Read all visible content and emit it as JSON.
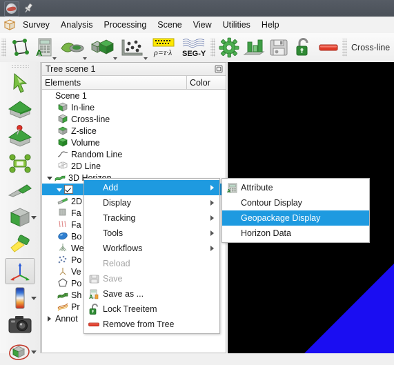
{
  "window": {
    "app_icon": "opendtect-globe-icon",
    "pin_icon": "pin-icon"
  },
  "menubar": {
    "logo_icon": "cube-logo-icon",
    "items": [
      {
        "label": "Survey",
        "name": "menu-survey"
      },
      {
        "label": "Analysis",
        "name": "menu-analysis"
      },
      {
        "label": "Processing",
        "name": "menu-processing"
      },
      {
        "label": "Scene",
        "name": "menu-scene"
      },
      {
        "label": "View",
        "name": "menu-view"
      },
      {
        "label": "Utilities",
        "name": "menu-utilities"
      },
      {
        "label": "Help",
        "name": "menu-help"
      }
    ]
  },
  "toolbar": {
    "buttons": [
      {
        "icon": "survey-polygon-icon",
        "name": "toolbar-survey-setup",
        "arrow": false
      },
      {
        "icon": "attribute-calculator-icon",
        "name": "toolbar-attributes",
        "arrow": true
      },
      {
        "icon": "cross-plot-icon",
        "name": "toolbar-crossplot",
        "arrow": true
      },
      {
        "icon": "volume-builder-icon",
        "name": "toolbar-volume-builder",
        "arrow": true
      },
      {
        "icon": "wells-scatter-icon",
        "name": "toolbar-manage-data",
        "arrow": true
      },
      {
        "icon": "rock-physics-icon",
        "name": "toolbar-rock-physics",
        "arrow": false
      },
      {
        "icon": "segy-icon",
        "name": "toolbar-segy",
        "arrow": false
      },
      {
        "icon": "gear-green-icon",
        "name": "toolbar-batch-processing",
        "arrow": false
      },
      {
        "icon": "bar-chart-icon",
        "name": "toolbar-statistics",
        "arrow": false
      },
      {
        "icon": "floppy-save-icon",
        "name": "toolbar-save-session",
        "arrow": false
      },
      {
        "icon": "padlock-open-green-icon",
        "name": "toolbar-lock",
        "arrow": false
      },
      {
        "icon": "red-bar-icon",
        "name": "toolbar-remove",
        "arrow": false
      }
    ],
    "trailing_label": "Cross-line"
  },
  "left_toolbar": {
    "buttons": [
      {
        "icon": "pick-arrow-icon",
        "name": "left-tool-pick",
        "arrow": false,
        "selected": false
      },
      {
        "icon": "green-house-icon",
        "name": "left-tool-home-view",
        "arrow": false,
        "selected": false
      },
      {
        "icon": "house-pin-icon",
        "name": "left-tool-save-home-view",
        "arrow": false,
        "selected": false
      },
      {
        "icon": "view-all-icon",
        "name": "left-tool-view-all",
        "arrow": false,
        "selected": false
      },
      {
        "icon": "inline-plane-icon",
        "name": "left-tool-view-inline",
        "arrow": false,
        "selected": false
      },
      {
        "icon": "cube-view-icon",
        "name": "left-tool-view-direction",
        "arrow": true,
        "selected": false
      },
      {
        "icon": "flashlight-icon",
        "name": "left-tool-headlight",
        "arrow": false,
        "selected": false
      },
      {
        "icon": "axis-triad-icon",
        "name": "left-tool-display-orientation",
        "arrow": false,
        "selected": true
      },
      {
        "icon": "colortable-icon",
        "name": "left-tool-colortable",
        "arrow": true,
        "selected": false
      },
      {
        "icon": "camera-icon",
        "name": "left-tool-snapshot",
        "arrow": false,
        "selected": false
      },
      {
        "icon": "polygon-select-icon",
        "name": "left-tool-polygon-selection",
        "arrow": true,
        "selected": false
      }
    ]
  },
  "tree": {
    "dock_title": "Tree scene 1",
    "float_icon": "float-dock-icon",
    "columns": [
      "Elements",
      "Color"
    ],
    "items": [
      {
        "label": "Scene 1",
        "icon": "",
        "indent": 18,
        "expander": "",
        "checkbox": false,
        "selected": false
      },
      {
        "label": "In-line",
        "icon": "inline-cube-icon",
        "indent": 22,
        "expander": "",
        "checkbox": false,
        "selected": false
      },
      {
        "label": "Cross-line",
        "icon": "crossline-cube-icon",
        "indent": 22,
        "expander": "",
        "checkbox": false,
        "selected": false
      },
      {
        "label": "Z-slice",
        "icon": "zslice-cube-icon",
        "indent": 22,
        "expander": "",
        "checkbox": false,
        "selected": false
      },
      {
        "label": "Volume",
        "icon": "volume-cube-icon",
        "indent": 22,
        "expander": "",
        "checkbox": false,
        "selected": false
      },
      {
        "label": "Random Line",
        "icon": "random-line-icon",
        "indent": 22,
        "expander": "",
        "checkbox": false,
        "selected": false
      },
      {
        "label": "2D Line",
        "icon": "2d-line-icon",
        "indent": 22,
        "expander": "",
        "checkbox": false,
        "selected": false
      },
      {
        "label": "3D Horizon",
        "icon": "horizon-3d-icon",
        "indent": 4,
        "expander": "down",
        "checkbox": false,
        "selected": false
      },
      {
        "label": "",
        "icon": "",
        "indent": 18,
        "expander": "down",
        "checkbox": true,
        "selected": true
      },
      {
        "label": "2D",
        "icon": "horizon-2d-icon",
        "indent": 22,
        "expander": "",
        "checkbox": false,
        "selected": false
      },
      {
        "label": "Fa",
        "icon": "fault-icon",
        "indent": 22,
        "expander": "",
        "checkbox": false,
        "selected": false
      },
      {
        "label": "Fa",
        "icon": "faultstickset-icon",
        "indent": 22,
        "expander": "",
        "checkbox": false,
        "selected": false
      },
      {
        "label": "Bo",
        "icon": "body-icon",
        "indent": 22,
        "expander": "",
        "checkbox": false,
        "selected": false
      },
      {
        "label": "We",
        "icon": "well-icon",
        "indent": 22,
        "expander": "",
        "checkbox": false,
        "selected": false
      },
      {
        "label": "Po",
        "icon": "pointset-icon",
        "indent": 22,
        "expander": "",
        "checkbox": false,
        "selected": false
      },
      {
        "label": "Ve",
        "icon": "vertical-icon",
        "indent": 22,
        "expander": "",
        "checkbox": false,
        "selected": false
      },
      {
        "label": "Po",
        "icon": "polygon-icon",
        "indent": 22,
        "expander": "",
        "checkbox": false,
        "selected": false
      },
      {
        "label": "Sh",
        "icon": "shape-icon",
        "indent": 22,
        "expander": "",
        "checkbox": false,
        "selected": false
      },
      {
        "label": "Pr",
        "icon": "prestack-icon",
        "indent": 22,
        "expander": "",
        "checkbox": false,
        "selected": false
      },
      {
        "label": "Annot",
        "icon": "",
        "indent": 4,
        "expander": "right",
        "checkbox": false,
        "selected": false
      }
    ]
  },
  "context_menu": {
    "items": [
      {
        "label": "Add",
        "icon": "",
        "name": "ctx-add",
        "submenu": true,
        "disabled": false,
        "highlighted": true
      },
      {
        "label": "Display",
        "icon": "",
        "name": "ctx-display",
        "submenu": true,
        "disabled": false,
        "highlighted": false
      },
      {
        "label": "Tracking",
        "icon": "",
        "name": "ctx-tracking",
        "submenu": true,
        "disabled": false,
        "highlighted": false
      },
      {
        "label": "Tools",
        "icon": "",
        "name": "ctx-tools",
        "submenu": true,
        "disabled": false,
        "highlighted": false
      },
      {
        "label": "Workflows",
        "icon": "",
        "name": "ctx-workflows",
        "submenu": true,
        "disabled": false,
        "highlighted": false
      },
      {
        "label": "Reload",
        "icon": "",
        "name": "ctx-reload",
        "submenu": false,
        "disabled": true,
        "highlighted": false
      },
      {
        "label": "Save",
        "icon": "floppy-gray-icon",
        "name": "ctx-save",
        "submenu": false,
        "disabled": true,
        "highlighted": false
      },
      {
        "label": "Save as ...",
        "icon": "save-as-icon",
        "name": "ctx-save-as",
        "submenu": false,
        "disabled": false,
        "highlighted": false
      },
      {
        "label": "Lock Treeitem",
        "icon": "padlock-open-green-icon",
        "name": "ctx-lock-treeitem",
        "submenu": false,
        "disabled": false,
        "highlighted": false
      },
      {
        "label": "Remove from Tree",
        "icon": "red-bar-icon",
        "name": "ctx-remove-from-tree",
        "submenu": false,
        "disabled": false,
        "highlighted": false
      }
    ]
  },
  "submenu": {
    "items": [
      {
        "label": "Attribute",
        "icon": "attribute-icon",
        "name": "submenu-attribute",
        "highlighted": false
      },
      {
        "label": "Contour Display",
        "icon": "",
        "name": "submenu-contour-display",
        "highlighted": false
      },
      {
        "label": "Geopackage Display",
        "icon": "",
        "name": "submenu-geopackage-display",
        "highlighted": true
      },
      {
        "label": "Horizon Data",
        "icon": "",
        "name": "submenu-horizon-data",
        "highlighted": false
      }
    ]
  },
  "viewport": {
    "background_color": "#000000",
    "horizon_color": "#1a0df2"
  }
}
